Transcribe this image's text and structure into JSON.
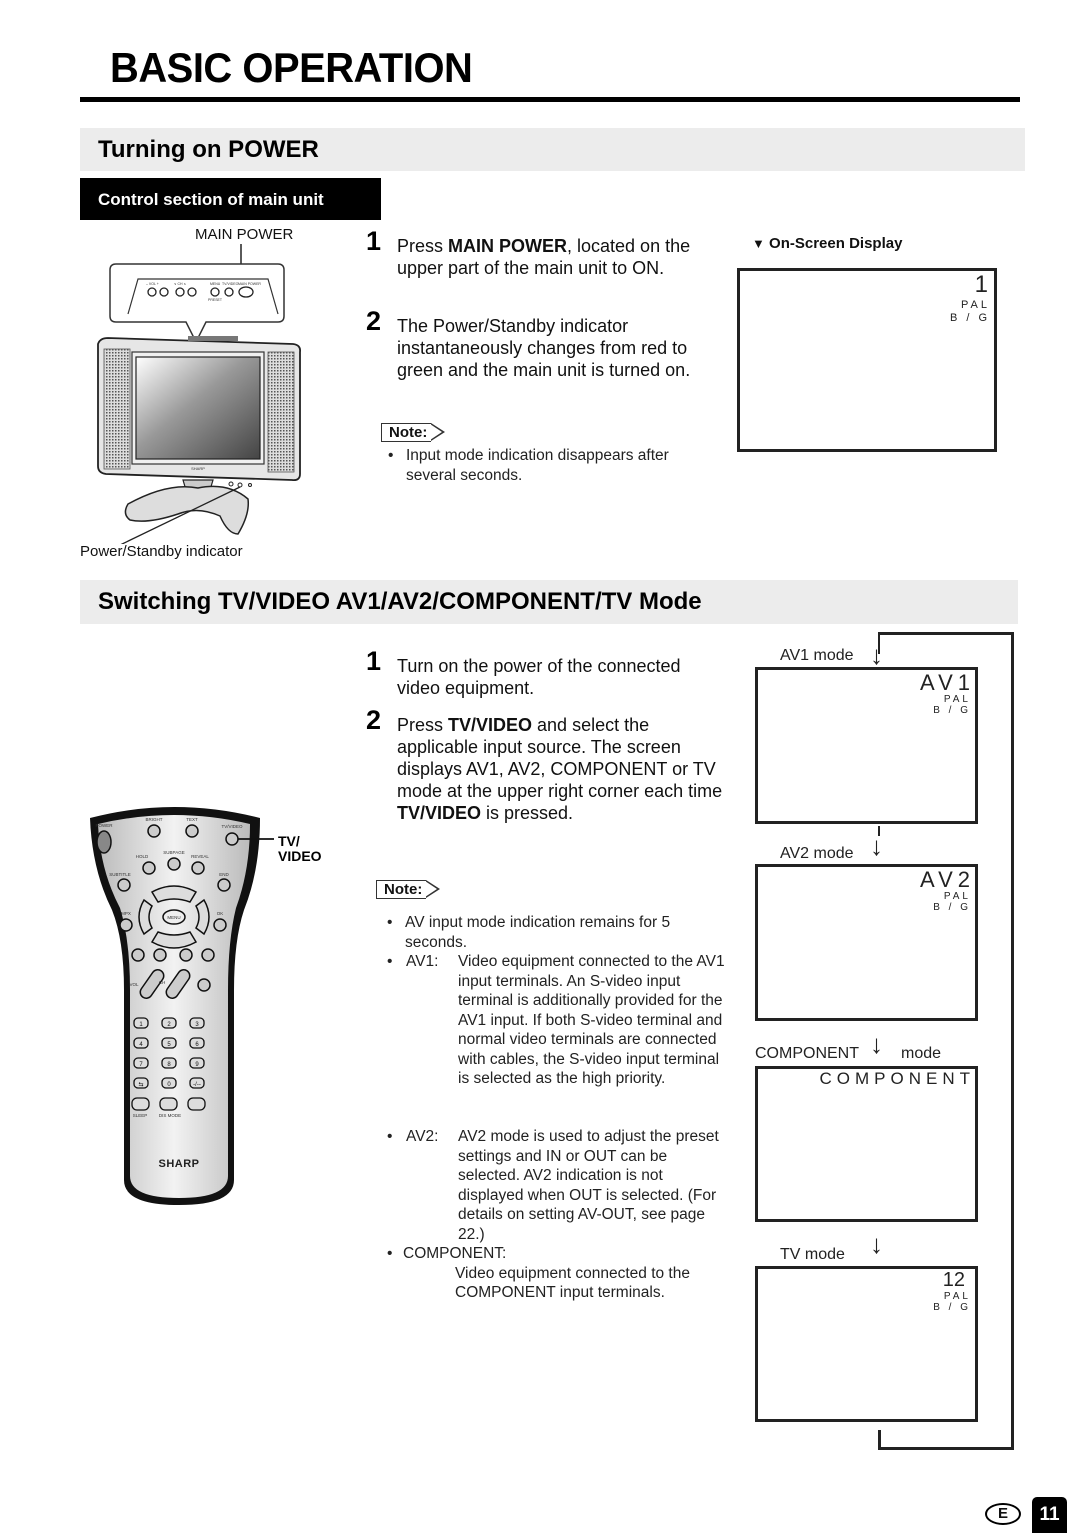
{
  "page": {
    "title": "BASIC OPERATION",
    "page_number": "11",
    "language_badge": "E"
  },
  "power_section": {
    "heading": "Turning on POWER",
    "control_label": "Control section of main unit",
    "main_power_label": "MAIN POWER",
    "indicator_label": "Power/Standby indicator",
    "panel_labels": [
      "– VOL +",
      "∨ CH ∧",
      "MENU",
      "TV/VIDEO",
      "MAIN POWER",
      "PRESET"
    ],
    "brand": "SHARP",
    "steps": [
      {
        "num": "1",
        "pre": "Press ",
        "bold": "MAIN POWER",
        "post": ", located on the upper part of the main unit to ON."
      },
      {
        "num": "2",
        "text": "The Power/Standby indicator instantaneously changes from red to green and the main unit is turned on."
      }
    ],
    "note_label": "Note:",
    "notes": [
      "Input mode indication disappears after several seconds."
    ],
    "osd": {
      "heading": "On-Screen Display",
      "channel": "1",
      "system_line1": "PAL",
      "system_line2": "B / G"
    }
  },
  "switch_section": {
    "heading": "Switching TV/VIDEO AV1/AV2/COMPONENT/TV Mode",
    "remote": {
      "callout_line1": "TV/",
      "callout_line2": "VIDEO",
      "button_labels": [
        "POWER",
        "BRIGHT",
        "TEXT",
        "TV/VIDEO",
        "HOLD",
        "SUBPAGE",
        "REVEAL",
        "SUBTITLE",
        "END",
        "MENU",
        "MPX",
        "OK",
        "VOL",
        "CH",
        "SLEEP",
        "DIS MODE"
      ],
      "number_keys": [
        "1",
        "2",
        "3",
        "4",
        "5",
        "6",
        "7",
        "8",
        "9",
        "⇆",
        "0",
        "-/--"
      ],
      "brand": "SHARP"
    },
    "steps": [
      {
        "num": "1",
        "text": "Turn on the power of the connected video equipment."
      },
      {
        "num": "2",
        "pre": "Press ",
        "bold1": "TV/VIDEO",
        "mid": " and select the applicable input source. The screen displays AV1, AV2, COMPONENT or TV mode at the upper right corner each time ",
        "bold2": "TV/VIDEO",
        "post": " is pressed."
      }
    ],
    "note_label": "Note:",
    "notes": {
      "general": "AV input mode indication remains for 5 seconds.",
      "av1_term": "AV1:",
      "av1_text": "Video equipment connected to the AV1 input terminals. An S-video input terminal is additionally provided for the AV1 input. If both S-video terminal and normal video terminals are connected with cables, the S-video input terminal is selected as the high priority.",
      "av2_term": "AV2:",
      "av2_text": "AV2 mode is used to adjust the preset settings and IN or OUT can be selected. AV2 indication is not displayed when OUT is selected. (For details on setting AV-OUT, see page 22.)",
      "component_term": "COMPONENT:",
      "component_text": "Video equipment connected to the COMPONENT input terminals."
    },
    "modes": [
      {
        "label": "AV1 mode",
        "display": "AV1",
        "system_line1": "PAL",
        "system_line2": "B / G"
      },
      {
        "label": "AV2 mode",
        "display": "AV2",
        "system_line1": "PAL",
        "system_line2": "B / G"
      },
      {
        "label_pre": "COMPONENT",
        "label_post": "mode",
        "display": "COMPONENT"
      },
      {
        "label": "TV mode",
        "display": "12",
        "system_line1": "PAL",
        "system_line2": "B / G"
      }
    ]
  }
}
